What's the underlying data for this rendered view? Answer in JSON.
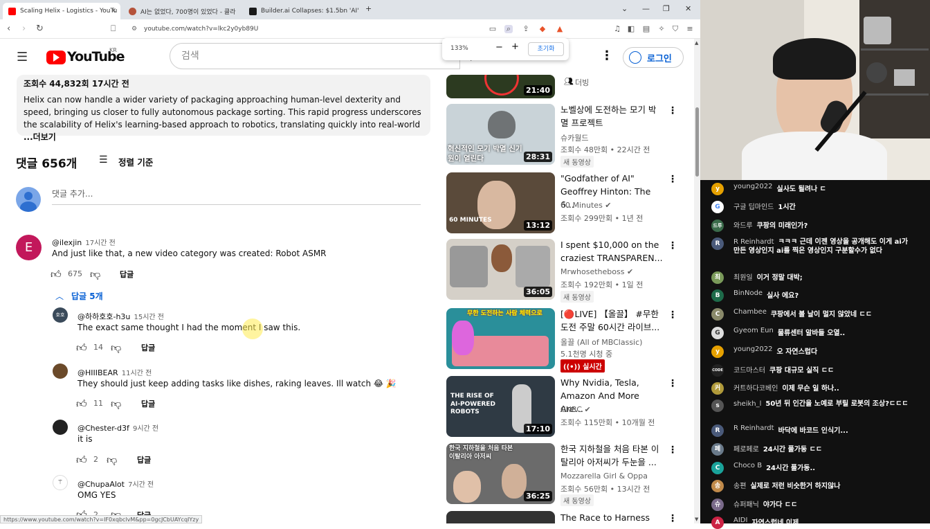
{
  "browser": {
    "tabs": [
      {
        "title": "Scaling Helix - Logistics - YouTu",
        "active": true
      },
      {
        "title": "AI는 없었다, 700명이 있었다 - 클라",
        "active": false
      },
      {
        "title": "Builder.ai Collapses: $1.5bn 'AI' Sta",
        "active": false
      }
    ],
    "new_tab": "+",
    "url": "youtube.com/watch?v=lkc2y0yb89U",
    "status_url": "https://www.youtube.com/watch?v=IF0xqbclvM&pp=0gcJCbUAYcqIYzy"
  },
  "zoom": {
    "level": "133%",
    "minus": "−",
    "plus": "+",
    "reset": "초기화"
  },
  "header": {
    "logo": "YouTube",
    "region": "KR",
    "search_placeholder": "검색",
    "login": "로그인"
  },
  "description": {
    "views": "조회수 44,832회  17시간 전",
    "text": "Helix can now handle a wider variety of packaging approaching human-level dexterity and speed, bringing us closer to fully autonomous package sorting. This rapid progress underscores the scalability of Helix's learning-based approach to robotics, translating quickly into real-world",
    "more": "...더보기"
  },
  "comments_header": {
    "count": "댓글 656개",
    "sort": "정렬 기준",
    "add_placeholder": "댓글 추가..."
  },
  "comments": [
    {
      "avatar_letter": "E",
      "author": "@ilexjin",
      "time": "17시간 전",
      "text": "And just like that, a new video category was created: Robot ASMR",
      "likes": "675",
      "reply": "답글",
      "replies_toggle": "답글 5개"
    }
  ],
  "replies": [
    {
      "author": "@하하호호-h3u",
      "time": "15시간 전",
      "text": "The exact same thought I had the moment I saw this.",
      "likes": "14",
      "reply": "답글"
    },
    {
      "author": "@HIIIBEAR",
      "time": "11시간 전",
      "text": "They should just keep adding tasks like dishes, raking leaves. Ill watch 😂 🎉",
      "likes": "11",
      "reply": "답글"
    },
    {
      "author": "@Chester-d3f",
      "time": "9시간 전",
      "text": "it is",
      "likes": "2",
      "reply": "답글"
    },
    {
      "author": "@ChupaAlot",
      "time": "7시간 전",
      "text": "OMG YES",
      "likes": "2",
      "reply": "답글"
    }
  ],
  "side_videos": [
    {
      "title_lines": [],
      "channel": "더빙",
      "meta": "",
      "badge": "",
      "duration": "21:40",
      "thumb_color": "#2c3a20"
    },
    {
      "title_lines": [
        "노벨상에 도전하는 모기 박",
        "멸 프로젝트"
      ],
      "channel": "슈카월드",
      "meta": "조회수 48만회 • 22시간 전",
      "badge": "새 동영상",
      "duration": "28:31",
      "thumb_color": "#c9d3d8",
      "thumb_text": "혁신적인 모기 박멸 신기원이 열린다"
    },
    {
      "title_lines": [
        "\"Godfather of AI\"",
        "Geoffrey Hinton: The 6..."
      ],
      "channel": "60 Minutes",
      "meta": "조회수 299만회 • 1년 전",
      "badge": "",
      "duration": "13:12",
      "thumb_color": "#5a4a3a",
      "thumb_text": "60 MINUTES"
    },
    {
      "title_lines": [
        "I spent $10,000 on the",
        "craziest TRANSPAREN..."
      ],
      "channel": "Mrwhosetheboss",
      "meta": "조회수 192만회 • 1일 전",
      "badge": "새 동영상",
      "duration": "36:05",
      "thumb_color": "#d5d0c8"
    },
    {
      "title_lines": [
        "[🔴LIVE] 【올끌】 #무한",
        "도전 주말 60시간 라이브..."
      ],
      "channel": "올끌 (All of MBClassic)",
      "meta": "5.1천명 시청 중",
      "badge": "",
      "live": "실시간",
      "duration": "",
      "thumb_color": "#2a8f9a",
      "thumb_text": "무한 도전하는 사람 체력으로"
    },
    {
      "title_lines": [
        "Why Nvidia, Tesla,",
        "Amazon And More Are..."
      ],
      "channel": "CNBC",
      "meta": "조회수 115만회 • 10개월 전",
      "badge": "",
      "duration": "17:10",
      "thumb_color": "#2f3a44",
      "thumb_text": "THE RISE OF AI-POWERED ROBOTS"
    },
    {
      "title_lines": [
        "한국 지하철을 처음 타본 이",
        "탈리아 아저씨가 두눈을 ..."
      ],
      "channel": "Mozzarella Girl & Oppa",
      "meta": "조회수 56만회 • 13시간 전",
      "badge": "새 동영상",
      "duration": "36:25",
      "thumb_color": "#6b6b6b",
      "thumb_text": "한국 지하철을 처음 타본 이탈리아 아저씨"
    },
    {
      "title_lines": [
        "The Race to Harness"
      ],
      "channel": "",
      "meta": "",
      "badge": "",
      "duration": "",
      "thumb_color": "#333"
    }
  ],
  "chat": [
    {
      "name": "young2022",
      "msg": "실사도 될려나 ㄷ",
      "color": "#e6a100",
      "letter": "y"
    },
    {
      "name": "구글 딥마인드",
      "msg": "1시간",
      "color": "#ffffff",
      "letter": "G"
    },
    {
      "name": "와드루",
      "msg": "쿠팡의 미래인가?",
      "color": "#3a6b4a",
      "letter": "드루"
    },
    {
      "name": "R Reinhardt",
      "msg": "ㅋㅋㅋ 근데 이젠 영상을 공개해도 이게 ai가 만든 영상인지 ai를 찍은 영상인지 구분할수가 없다",
      "color": "#4a5a7a",
      "letter": "R"
    },
    {
      "name": "최원일",
      "msg": "이거 정말 대박;",
      "color": "#7a9a5a",
      "letter": "최"
    },
    {
      "name": "BinNode",
      "msg": "실사 에요?",
      "color": "#1e6b4a",
      "letter": "B"
    },
    {
      "name": "Chambee",
      "msg": "쿠팡에서 볼 날이 멀지 않았네 ㄷㄷ",
      "color": "#8a8a6a",
      "letter": "C"
    },
    {
      "name": "Gyeom Eun",
      "msg": "물류센터 알바들 오열..",
      "color": "#dddddd",
      "letter": "G"
    },
    {
      "name": "young2022",
      "msg": "오 자연스럽다",
      "color": "#e6a100",
      "letter": "y"
    },
    {
      "name": "코드마스터",
      "msg": "쿠팡 대규모 실직 ㄷㄷ",
      "color": "#222222",
      "letter": "CODE"
    },
    {
      "name": "커트하다코베인",
      "msg": "이제 무슨 일 하나..",
      "color": "#b09a3a",
      "letter": "커"
    },
    {
      "name": "sheikh_l",
      "msg": "50년 뒤 인간을 노예로 부릴 로봇의 조상?ㄷㄷㄷ",
      "color": "#555555",
      "letter": "s"
    },
    {
      "name": "R Reinhardt",
      "msg": "바닥에 바코드 인식기...",
      "color": "#4a5a7a",
      "letter": "R"
    },
    {
      "name": "페로페로",
      "msg": "24시간 풀가동 ㄷㄷ",
      "color": "#6a7a8a",
      "letter": "페"
    },
    {
      "name": "Choco B",
      "msg": "24시간 풀가동..",
      "color": "#1aa39a",
      "letter": "C"
    },
    {
      "name": "송편",
      "msg": "실제로 저런 비슷한거 하지않나",
      "color": "#c08a4a",
      "letter": "송"
    },
    {
      "name": "슈퍼패닉",
      "msg": "야가다 ㄷㄷ",
      "color": "#7a6a8a",
      "letter": "슈"
    },
    {
      "name": "AIDI",
      "msg": "자연스럽네 이제",
      "color": "#cc2244",
      "letter": "A"
    }
  ]
}
